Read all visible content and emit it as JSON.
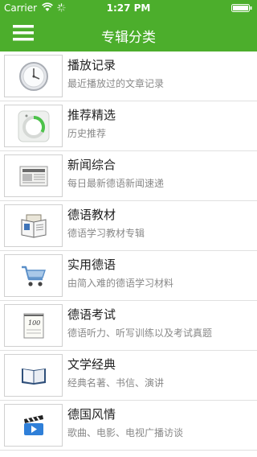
{
  "status_bar": {
    "carrier": "Carrier",
    "time": "1:27 PM"
  },
  "header": {
    "title": "专辑分类"
  },
  "categories": [
    {
      "title": "播放记录",
      "subtitle": "最近播放过的文章记录",
      "icon": "clock-icon"
    },
    {
      "title": "推荐精选",
      "subtitle": "历史推荐",
      "icon": "progress-dial-icon"
    },
    {
      "title": "新闻综合",
      "subtitle": "每日最新德语新闻速递",
      "icon": "newspaper-icon"
    },
    {
      "title": "德语教材",
      "subtitle": "德语学习教材专辑",
      "icon": "textbook-icon"
    },
    {
      "title": "实用德语",
      "subtitle": "由简入难的德语学习材料",
      "icon": "shopping-cart-icon"
    },
    {
      "title": "德语考试",
      "subtitle": "德语听力、听写训练以及考试真题",
      "icon": "exam-paper-icon"
    },
    {
      "title": "文学经典",
      "subtitle": "经典名著、书信、演讲",
      "icon": "open-book-icon"
    },
    {
      "title": "德国风情",
      "subtitle": "歌曲、电影、电视广播访谈",
      "icon": "clapperboard-icon"
    }
  ],
  "exam_score_text": "100"
}
